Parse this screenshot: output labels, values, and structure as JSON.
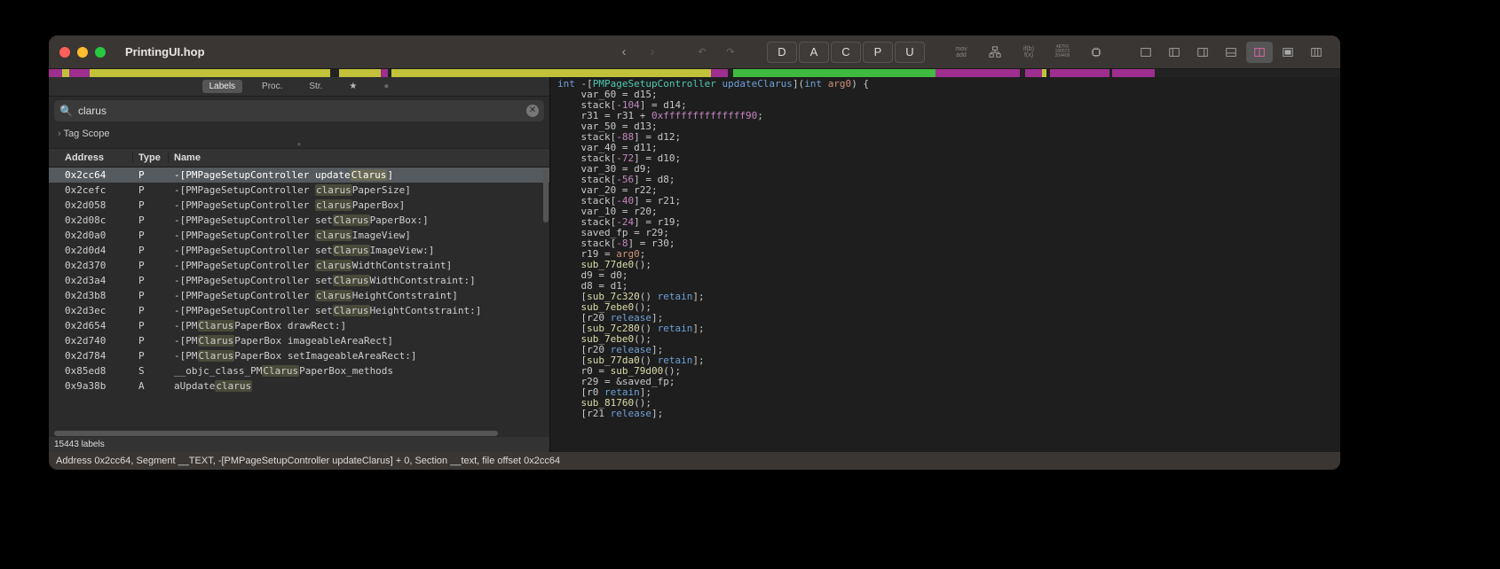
{
  "window": {
    "title": "PrintingUI.hop"
  },
  "toolbar": {
    "letters": [
      "D",
      "A",
      "C",
      "P",
      "U"
    ],
    "mini1": "mov\nadd",
    "mini2": "if(b)\nf(x)",
    "mini3": "487F0\n190572\n204409"
  },
  "overview": [
    {
      "w": 0.8,
      "c": "#9e2f8f"
    },
    {
      "w": 0.4,
      "c": "#c2c23a"
    },
    {
      "w": 1.2,
      "c": "#9e2f8f"
    },
    {
      "w": 0.3,
      "c": "#c2c23a"
    },
    {
      "w": 14,
      "c": "#c2c23a"
    },
    {
      "w": 0.5,
      "c": "#222"
    },
    {
      "w": 2.5,
      "c": "#c2c23a"
    },
    {
      "w": 0.4,
      "c": "#9e2f8f"
    },
    {
      "w": 0.2,
      "c": "#222"
    },
    {
      "w": 19,
      "c": "#c2c23a"
    },
    {
      "w": 1.0,
      "c": "#9e2f8f"
    },
    {
      "w": 0.3,
      "c": "#222"
    },
    {
      "w": 12,
      "c": "#3fbb3f"
    },
    {
      "w": 1.0,
      "c": "#9e2f8f"
    },
    {
      "w": 4.0,
      "c": "#9e2f8f"
    },
    {
      "w": 0.3,
      "c": "#222"
    },
    {
      "w": 1.0,
      "c": "#9e2f8f"
    },
    {
      "w": 0.3,
      "c": "#c2c23a"
    },
    {
      "w": 0.2,
      "c": "#222"
    },
    {
      "w": 3.5,
      "c": "#9e2f8f"
    },
    {
      "w": 0.2,
      "c": "#222"
    },
    {
      "w": 2.5,
      "c": "#9e2f8f"
    },
    {
      "w": 11,
      "c": "#222"
    }
  ],
  "sidebar": {
    "tags": [
      "Labels",
      "Proc.",
      "Str.",
      "★",
      "●"
    ],
    "activeTag": 0,
    "search": {
      "placeholder": "Search",
      "value": "clarus"
    },
    "scope": "Tag Scope",
    "columns": {
      "addr": "Address",
      "type": "Type",
      "name": "Name"
    },
    "rows": [
      {
        "addr": "0x2cc64",
        "type": "P",
        "pre": "-[PMPageSetupController update",
        "match": "Clarus",
        "post": "]",
        "sel": true
      },
      {
        "addr": "0x2cefc",
        "type": "P",
        "pre": "-[PMPageSetupController ",
        "match": "clarus",
        "post": "PaperSize]"
      },
      {
        "addr": "0x2d058",
        "type": "P",
        "pre": "-[PMPageSetupController ",
        "match": "clarus",
        "post": "PaperBox]"
      },
      {
        "addr": "0x2d08c",
        "type": "P",
        "pre": "-[PMPageSetupController set",
        "match": "Clarus",
        "post": "PaperBox:]"
      },
      {
        "addr": "0x2d0a0",
        "type": "P",
        "pre": "-[PMPageSetupController ",
        "match": "clarus",
        "post": "ImageView]"
      },
      {
        "addr": "0x2d0d4",
        "type": "P",
        "pre": "-[PMPageSetupController set",
        "match": "Clarus",
        "post": "ImageView:]"
      },
      {
        "addr": "0x2d370",
        "type": "P",
        "pre": "-[PMPageSetupController ",
        "match": "clarus",
        "post": "WidthContstraint]"
      },
      {
        "addr": "0x2d3a4",
        "type": "P",
        "pre": "-[PMPageSetupController set",
        "match": "Clarus",
        "post": "WidthContstraint:]"
      },
      {
        "addr": "0x2d3b8",
        "type": "P",
        "pre": "-[PMPageSetupController ",
        "match": "clarus",
        "post": "HeightContstraint]"
      },
      {
        "addr": "0x2d3ec",
        "type": "P",
        "pre": "-[PMPageSetupController set",
        "match": "Clarus",
        "post": "HeightContstraint:]"
      },
      {
        "addr": "0x2d654",
        "type": "P",
        "pre": "-[PM",
        "match": "Clarus",
        "post": "PaperBox drawRect:]"
      },
      {
        "addr": "0x2d740",
        "type": "P",
        "pre": "-[PM",
        "match": "Clarus",
        "post": "PaperBox imageableAreaRect]"
      },
      {
        "addr": "0x2d784",
        "type": "P",
        "pre": "-[PM",
        "match": "Clarus",
        "post": "PaperBox setImageableAreaRect:]"
      },
      {
        "addr": "0x85ed8",
        "type": "S",
        "pre": "__objc_class_PM",
        "match": "Clarus",
        "post": "PaperBox_methods"
      },
      {
        "addr": "0x9a38b",
        "type": "A",
        "pre": "aUpdate",
        "match": "clarus",
        "post": ""
      }
    ],
    "footer": "15443 labels"
  },
  "code_lines": [
    [
      [
        "kw",
        "int"
      ],
      [
        "pn",
        " -["
      ],
      [
        "gr",
        "PMPageSetupController"
      ],
      [
        "pn",
        " "
      ],
      [
        "mt",
        "updateClarus"
      ],
      [
        "pn",
        "]("
      ],
      [
        "kw",
        "int"
      ],
      [
        "pn",
        " "
      ],
      [
        "or",
        "arg0"
      ],
      [
        "pn",
        ") {"
      ]
    ],
    [
      [
        "pn",
        "    "
      ],
      [
        "id",
        "var_60"
      ],
      [
        "pn",
        " = "
      ],
      [
        "id",
        "d15"
      ],
      [
        "pn",
        ";"
      ]
    ],
    [
      [
        "pn",
        "    "
      ],
      [
        "id",
        "stack"
      ],
      [
        "pn",
        "["
      ],
      [
        "nm",
        "-104"
      ],
      [
        "pn",
        "] = "
      ],
      [
        "id",
        "d14"
      ],
      [
        "pn",
        ";"
      ]
    ],
    [
      [
        "pn",
        "    "
      ],
      [
        "id",
        "r31"
      ],
      [
        "pn",
        " = "
      ],
      [
        "id",
        "r31"
      ],
      [
        "pn",
        " + "
      ],
      [
        "nm",
        "0xffffffffffffff90"
      ],
      [
        "pn",
        ";"
      ]
    ],
    [
      [
        "pn",
        "    "
      ],
      [
        "id",
        "var_50"
      ],
      [
        "pn",
        " = "
      ],
      [
        "id",
        "d13"
      ],
      [
        "pn",
        ";"
      ]
    ],
    [
      [
        "pn",
        "    "
      ],
      [
        "id",
        "stack"
      ],
      [
        "pn",
        "["
      ],
      [
        "nm",
        "-88"
      ],
      [
        "pn",
        "] = "
      ],
      [
        "id",
        "d12"
      ],
      [
        "pn",
        ";"
      ]
    ],
    [
      [
        "pn",
        "    "
      ],
      [
        "id",
        "var_40"
      ],
      [
        "pn",
        " = "
      ],
      [
        "id",
        "d11"
      ],
      [
        "pn",
        ";"
      ]
    ],
    [
      [
        "pn",
        "    "
      ],
      [
        "id",
        "stack"
      ],
      [
        "pn",
        "["
      ],
      [
        "nm",
        "-72"
      ],
      [
        "pn",
        "] = "
      ],
      [
        "id",
        "d10"
      ],
      [
        "pn",
        ";"
      ]
    ],
    [
      [
        "pn",
        "    "
      ],
      [
        "id",
        "var_30"
      ],
      [
        "pn",
        " = "
      ],
      [
        "id",
        "d9"
      ],
      [
        "pn",
        ";"
      ]
    ],
    [
      [
        "pn",
        "    "
      ],
      [
        "id",
        "stack"
      ],
      [
        "pn",
        "["
      ],
      [
        "nm",
        "-56"
      ],
      [
        "pn",
        "] = "
      ],
      [
        "id",
        "d8"
      ],
      [
        "pn",
        ";"
      ]
    ],
    [
      [
        "pn",
        "    "
      ],
      [
        "id",
        "var_20"
      ],
      [
        "pn",
        " = "
      ],
      [
        "id",
        "r22"
      ],
      [
        "pn",
        ";"
      ]
    ],
    [
      [
        "pn",
        "    "
      ],
      [
        "id",
        "stack"
      ],
      [
        "pn",
        "["
      ],
      [
        "nm",
        "-40"
      ],
      [
        "pn",
        "] = "
      ],
      [
        "id",
        "r21"
      ],
      [
        "pn",
        ";"
      ]
    ],
    [
      [
        "pn",
        "    "
      ],
      [
        "id",
        "var_10"
      ],
      [
        "pn",
        " = "
      ],
      [
        "id",
        "r20"
      ],
      [
        "pn",
        ";"
      ]
    ],
    [
      [
        "pn",
        "    "
      ],
      [
        "id",
        "stack"
      ],
      [
        "pn",
        "["
      ],
      [
        "nm",
        "-24"
      ],
      [
        "pn",
        "] = "
      ],
      [
        "id",
        "r19"
      ],
      [
        "pn",
        ";"
      ]
    ],
    [
      [
        "pn",
        "    "
      ],
      [
        "id",
        "saved_fp"
      ],
      [
        "pn",
        " = "
      ],
      [
        "id",
        "r29"
      ],
      [
        "pn",
        ";"
      ]
    ],
    [
      [
        "pn",
        "    "
      ],
      [
        "id",
        "stack"
      ],
      [
        "pn",
        "["
      ],
      [
        "nm",
        "-8"
      ],
      [
        "pn",
        "] = "
      ],
      [
        "id",
        "r30"
      ],
      [
        "pn",
        ";"
      ]
    ],
    [
      [
        "pn",
        "    "
      ],
      [
        "id",
        "r19"
      ],
      [
        "pn",
        " = "
      ],
      [
        "or",
        "arg0"
      ],
      [
        "pn",
        ";"
      ]
    ],
    [
      [
        "pn",
        "    "
      ],
      [
        "yl",
        "sub_77de0"
      ],
      [
        "pn",
        "();"
      ]
    ],
    [
      [
        "pn",
        "    "
      ],
      [
        "id",
        "d9"
      ],
      [
        "pn",
        " = "
      ],
      [
        "id",
        "d0"
      ],
      [
        "pn",
        ";"
      ]
    ],
    [
      [
        "pn",
        "    "
      ],
      [
        "id",
        "d8"
      ],
      [
        "pn",
        " = "
      ],
      [
        "id",
        "d1"
      ],
      [
        "pn",
        ";"
      ]
    ],
    [
      [
        "pn",
        "    ["
      ],
      [
        "yl",
        "sub_7c320"
      ],
      [
        "pn",
        "() "
      ],
      [
        "mt",
        "retain"
      ],
      [
        "pn",
        "];"
      ]
    ],
    [
      [
        "pn",
        "    "
      ],
      [
        "yl",
        "sub_7ebe0"
      ],
      [
        "pn",
        "();"
      ]
    ],
    [
      [
        "pn",
        "    ["
      ],
      [
        "id",
        "r20"
      ],
      [
        "pn",
        " "
      ],
      [
        "mt",
        "release"
      ],
      [
        "pn",
        "];"
      ]
    ],
    [
      [
        "pn",
        "    ["
      ],
      [
        "yl",
        "sub_7c280"
      ],
      [
        "pn",
        "() "
      ],
      [
        "mt",
        "retain"
      ],
      [
        "pn",
        "];"
      ]
    ],
    [
      [
        "pn",
        "    "
      ],
      [
        "yl",
        "sub_7ebe0"
      ],
      [
        "pn",
        "();"
      ]
    ],
    [
      [
        "pn",
        "    ["
      ],
      [
        "id",
        "r20"
      ],
      [
        "pn",
        " "
      ],
      [
        "mt",
        "release"
      ],
      [
        "pn",
        "];"
      ]
    ],
    [
      [
        "pn",
        "    ["
      ],
      [
        "yl",
        "sub_77da0"
      ],
      [
        "pn",
        "() "
      ],
      [
        "mt",
        "retain"
      ],
      [
        "pn",
        "];"
      ]
    ],
    [
      [
        "pn",
        "    "
      ],
      [
        "id",
        "r0"
      ],
      [
        "pn",
        " = "
      ],
      [
        "yl",
        "sub_79d00"
      ],
      [
        "pn",
        "();"
      ]
    ],
    [
      [
        "pn",
        "    "
      ],
      [
        "id",
        "r29"
      ],
      [
        "pn",
        " = &"
      ],
      [
        "id",
        "saved_fp"
      ],
      [
        "pn",
        ";"
      ]
    ],
    [
      [
        "pn",
        "    ["
      ],
      [
        "id",
        "r0"
      ],
      [
        "pn",
        " "
      ],
      [
        "mt",
        "retain"
      ],
      [
        "pn",
        "];"
      ]
    ],
    [
      [
        "pn",
        "    "
      ],
      [
        "yl",
        "sub_81760"
      ],
      [
        "pn",
        "();"
      ]
    ],
    [
      [
        "pn",
        "    ["
      ],
      [
        "id",
        "r21"
      ],
      [
        "pn",
        " "
      ],
      [
        "mt",
        "release"
      ],
      [
        "pn",
        "];"
      ]
    ]
  ],
  "status": "Address 0x2cc64, Segment __TEXT, -[PMPageSetupController updateClarus] + 0, Section __text, file offset 0x2cc64"
}
